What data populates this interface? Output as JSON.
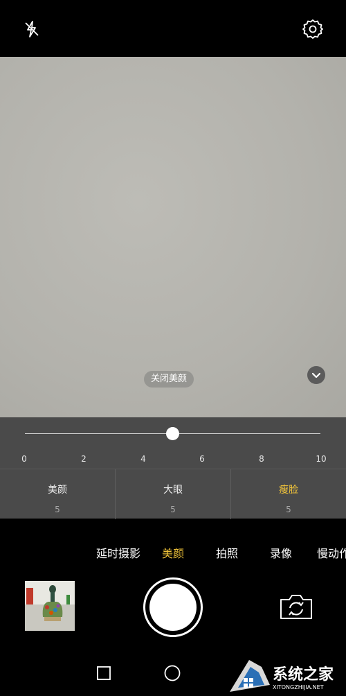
{
  "topbar": {
    "flash_icon": "flash-off-icon",
    "settings_icon": "settings-gear-icon"
  },
  "viewfinder": {
    "beauty_off_label": "关闭美颜",
    "collapse_icon": "chevron-down-icon"
  },
  "slider": {
    "ticks": [
      "0",
      "2",
      "4",
      "6",
      "8",
      "10"
    ],
    "value": 5,
    "min": 0,
    "max": 10
  },
  "beauty_tabs": [
    {
      "label": "美颜",
      "value": "5"
    },
    {
      "label": "大眼",
      "value": "5"
    },
    {
      "label": "瘦脸",
      "value": "5",
      "active": true
    }
  ],
  "modes": [
    {
      "label": "延时摄影"
    },
    {
      "label": "美颜",
      "active": true
    },
    {
      "label": "拍照"
    },
    {
      "label": "录像"
    },
    {
      "label": "慢动作"
    }
  ],
  "controls": {
    "gallery_icon": "gallery-thumbnail",
    "shutter_icon": "shutter-button",
    "switch_icon": "switch-camera-icon"
  },
  "navbar": {
    "recent_icon": "square-recent-icon",
    "home_icon": "circle-home-icon"
  },
  "watermark": {
    "title": "系统之家",
    "subtitle": "XITONGZHIJIA.NET"
  },
  "colors": {
    "accent": "#f0c33a",
    "panel": "#4a4a4a",
    "background": "#000000"
  }
}
